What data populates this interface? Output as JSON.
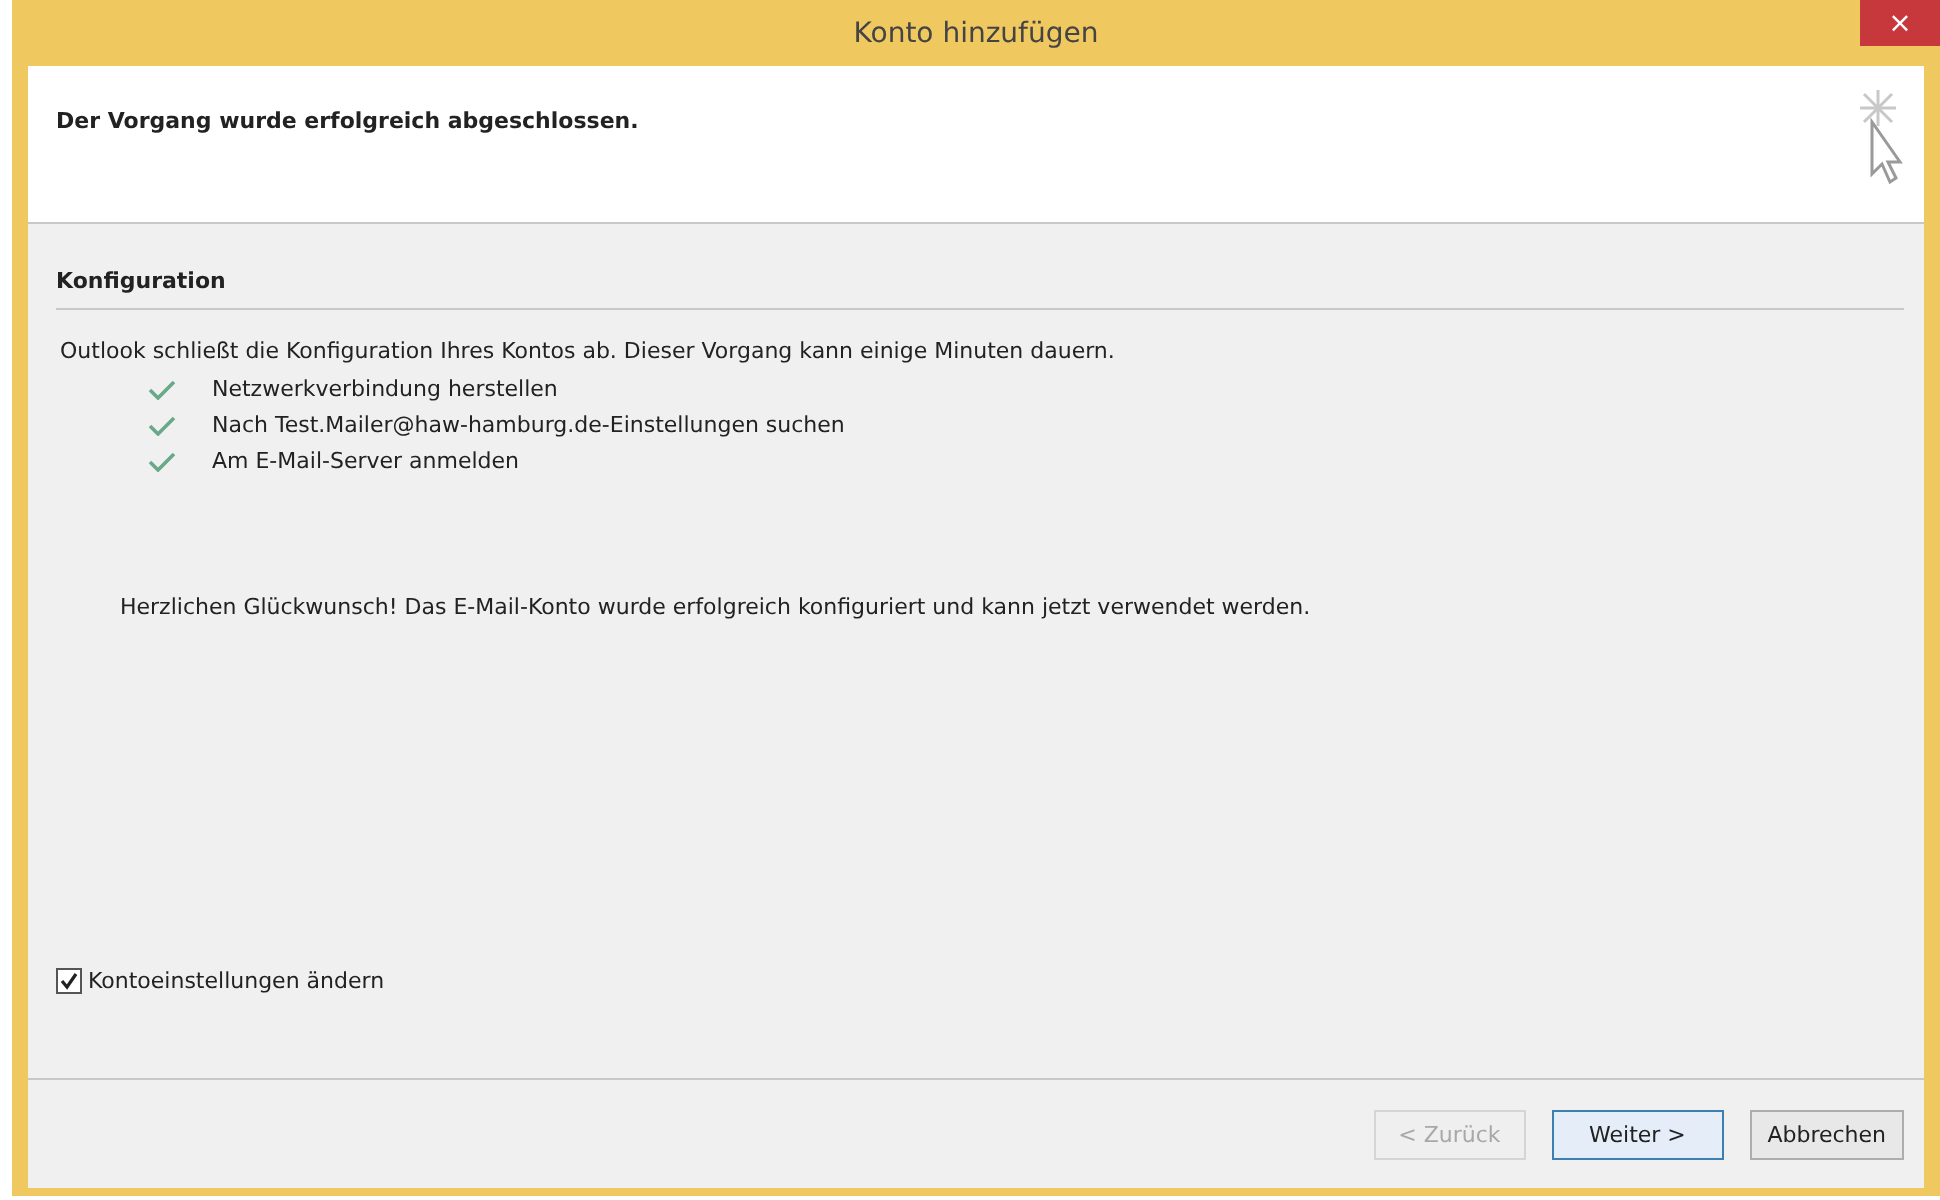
{
  "window": {
    "title": "Konto hinzufügen",
    "close": "×"
  },
  "header": {
    "message": "Der Vorgang wurde erfolgreich abgeschlossen."
  },
  "section": {
    "title": "Konfiguration"
  },
  "intro": "Outlook schließt die Konfiguration Ihres Kontos ab. Dieser Vorgang kann einige Minuten dauern.",
  "steps": [
    {
      "label": "Netzwerkverbindung herstellen",
      "done": true
    },
    {
      "label": "Nach Test.Mailer@haw-hamburg.de-Einstellungen suchen",
      "done": true
    },
    {
      "label": "Am E-Mail-Server anmelden",
      "done": true
    }
  ],
  "result": "Herzlichen Glückwunsch! Das E-Mail-Konto wurde erfolgreich konfiguriert und kann jetzt verwendet werden.",
  "option": {
    "label": "Kontoeinstellungen ändern",
    "checked": true
  },
  "buttons": [
    {
      "label": "< Zurück",
      "disabled": true,
      "default": false
    },
    {
      "label": "Weiter >",
      "disabled": false,
      "default": true
    },
    {
      "label": "Abbrechen",
      "disabled": false,
      "default": false
    }
  ]
}
